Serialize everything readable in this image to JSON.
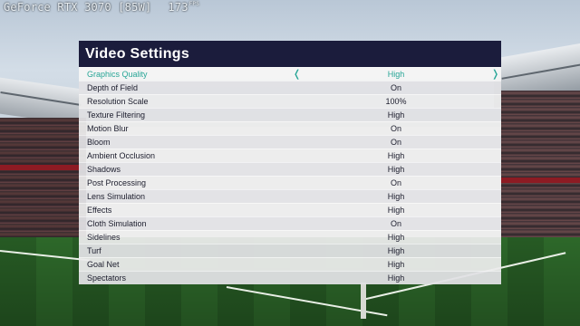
{
  "hud": {
    "gpu": "GeForce RTX 3070 [85W]",
    "fps": "173",
    "fps_unit": "FPS"
  },
  "panel": {
    "title": "Video Settings",
    "arrow_left": "❬",
    "arrow_right": "❭",
    "rows": [
      {
        "label": "Graphics Quality",
        "value": "High",
        "selected": true
      },
      {
        "label": "Depth of Field",
        "value": "On"
      },
      {
        "label": "Resolution Scale",
        "value": "100%"
      },
      {
        "label": "Texture Filtering",
        "value": "High"
      },
      {
        "label": "Motion Blur",
        "value": "On"
      },
      {
        "label": "Bloom",
        "value": "On"
      },
      {
        "label": "Ambient Occlusion",
        "value": "High"
      },
      {
        "label": "Shadows",
        "value": "High"
      },
      {
        "label": "Post Processing",
        "value": "On"
      },
      {
        "label": "Lens Simulation",
        "value": "High"
      },
      {
        "label": "Effects",
        "value": "High"
      },
      {
        "label": "Cloth Simulation",
        "value": "On"
      },
      {
        "label": "Sidelines",
        "value": "High"
      },
      {
        "label": "Turf",
        "value": "High"
      },
      {
        "label": "Goal Net",
        "value": "High"
      },
      {
        "label": "Spectators",
        "value": "High"
      }
    ]
  },
  "colors": {
    "header_bg": "#1b1c3c",
    "accent": "#27a596"
  }
}
